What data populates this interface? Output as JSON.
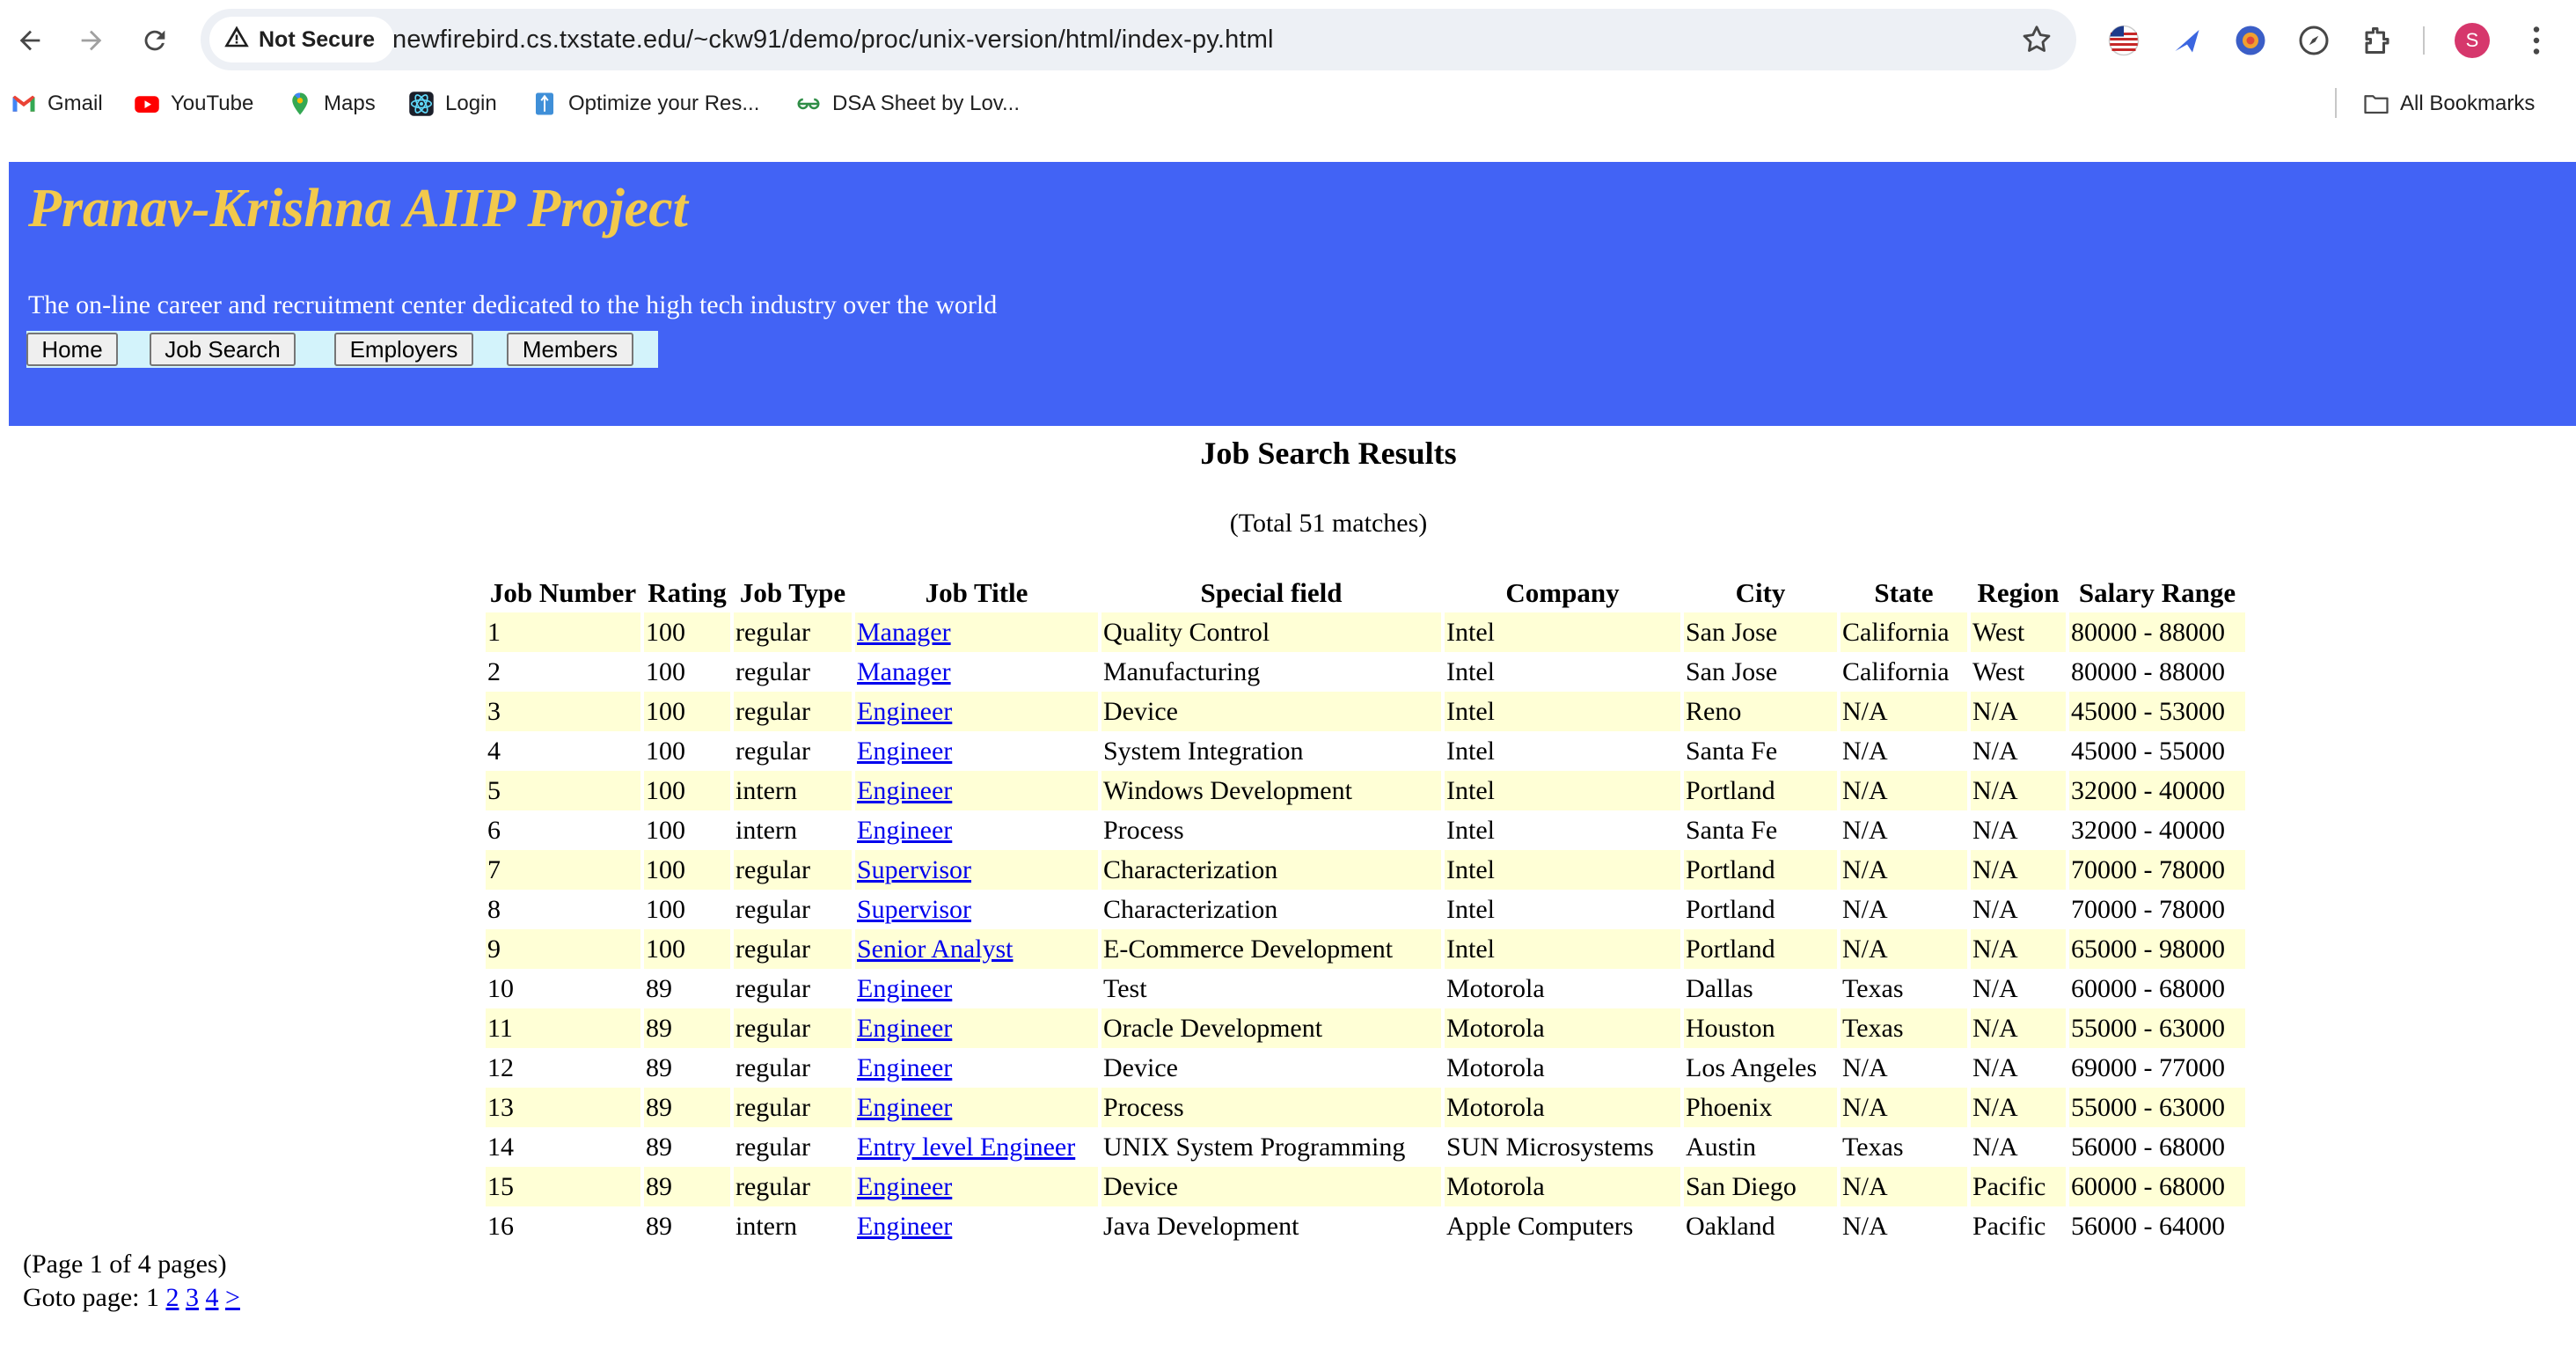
{
  "browser": {
    "security_label": "Not Secure",
    "url": "newfirebird.cs.txstate.edu/~ckw91/demo/proc/unix-version/html/index-py.html",
    "profile_initial": "S",
    "bookmarks": [
      "Gmail",
      "YouTube",
      "Maps",
      "Login",
      "Optimize your Res...",
      "DSA Sheet by Lov..."
    ],
    "all_bookmarks": "All Bookmarks",
    "icons": [
      "back-arrow-icon",
      "forward-arrow-icon",
      "reload-icon",
      "warning-icon",
      "star-icon",
      "us-flag-icon",
      "send-icon",
      "extension-circle-icon",
      "compass-icon",
      "puzzle-icon",
      "menu-dots-icon",
      "folder-icon"
    ]
  },
  "site": {
    "title": "Pranav-Krishna AIIP Project",
    "tagline": "The on-line career and recruitment center dedicated to the high tech industry over the world",
    "menu": [
      "Home",
      "Job Search",
      "Employers",
      "Members"
    ],
    "colors": {
      "banner": "#4263f5",
      "title": "#f2c94c",
      "menu_strip": "#d3f3fb",
      "row_alt": "#ffffd6",
      "link": "#0000ee"
    }
  },
  "results": {
    "title": "Job Search Results",
    "count": "(Total 51 matches)",
    "columns": [
      "Job Number",
      "Rating",
      "Job Type",
      "Job Title",
      "Special field",
      "Company",
      "City",
      "State",
      "Region",
      "Salary Range"
    ],
    "rows": [
      [
        "1",
        "100",
        "regular",
        "Manager",
        "Quality Control",
        "Intel",
        "San Jose",
        "California",
        "West",
        "80000 - 88000"
      ],
      [
        "2",
        "100",
        "regular",
        "Manager",
        "Manufacturing",
        "Intel",
        "San Jose",
        "California",
        "West",
        "80000 - 88000"
      ],
      [
        "3",
        "100",
        "regular",
        "Engineer",
        "Device",
        "Intel",
        "Reno",
        "N/A",
        "N/A",
        "45000 - 53000"
      ],
      [
        "4",
        "100",
        "regular",
        "Engineer",
        "System Integration",
        "Intel",
        "Santa Fe",
        "N/A",
        "N/A",
        "45000 - 55000"
      ],
      [
        "5",
        "100",
        "intern",
        "Engineer",
        "Windows Development",
        "Intel",
        "Portland",
        "N/A",
        "N/A",
        "32000 - 40000"
      ],
      [
        "6",
        "100",
        "intern",
        "Engineer",
        "Process",
        "Intel",
        "Santa Fe",
        "N/A",
        "N/A",
        "32000 - 40000"
      ],
      [
        "7",
        "100",
        "regular",
        "Supervisor",
        "Characterization",
        "Intel",
        "Portland",
        "N/A",
        "N/A",
        "70000 - 78000"
      ],
      [
        "8",
        "100",
        "regular",
        "Supervisor",
        "Characterization",
        "Intel",
        "Portland",
        "N/A",
        "N/A",
        "70000 - 78000"
      ],
      [
        "9",
        "100",
        "regular",
        "Senior Analyst",
        "E-Commerce Development",
        "Intel",
        "Portland",
        "N/A",
        "N/A",
        "65000 - 98000"
      ],
      [
        "10",
        "89",
        "regular",
        "Engineer",
        "Test",
        "Motorola",
        "Dallas",
        "Texas",
        "N/A",
        "60000 - 68000"
      ],
      [
        "11",
        "89",
        "regular",
        "Engineer",
        "Oracle Development",
        "Motorola",
        "Houston",
        "Texas",
        "N/A",
        "55000 - 63000"
      ],
      [
        "12",
        "89",
        "regular",
        "Engineer",
        "Device",
        "Motorola",
        "Los Angeles",
        "N/A",
        "N/A",
        "69000 - 77000"
      ],
      [
        "13",
        "89",
        "regular",
        "Engineer",
        "Process",
        "Motorola",
        "Phoenix",
        "N/A",
        "N/A",
        "55000 - 63000"
      ],
      [
        "14",
        "89",
        "regular",
        "Entry level Engineer",
        "UNIX System Programming",
        "SUN Microsystems",
        "Austin",
        "Texas",
        "N/A",
        "56000 - 68000"
      ],
      [
        "15",
        "89",
        "regular",
        "Engineer",
        "Device",
        "Motorola",
        "San Diego",
        "N/A",
        "Pacific",
        "60000 - 68000"
      ],
      [
        "16",
        "89",
        "intern",
        "Engineer",
        "Java Development",
        "Apple Computers",
        "Oakland",
        "N/A",
        "Pacific",
        "56000 - 64000"
      ]
    ]
  },
  "pagination": {
    "status": "(Page 1 of 4 pages)",
    "goto_label": "Goto page:",
    "current": "1",
    "links": [
      "2",
      "3",
      "4",
      ">"
    ]
  }
}
